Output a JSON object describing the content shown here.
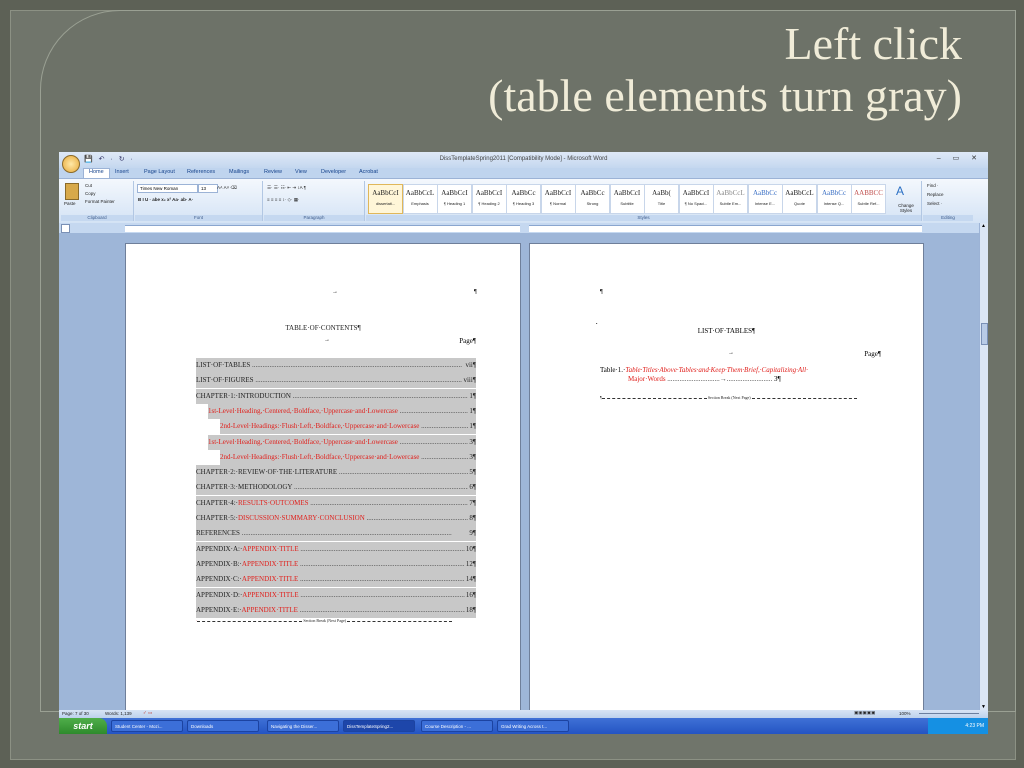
{
  "slide": {
    "title_line1": "Left click",
    "title_line2": "(table elements turn gray)"
  },
  "window": {
    "title": "DissTemplateSpring2011 [Compatibility Mode] - Microsoft Word",
    "qat": "💾 ↶ · ↻ ·",
    "controls": "– ▭ ✕"
  },
  "tabs": [
    "Home",
    "Insert",
    "Page Layout",
    "References",
    "Mailings",
    "Review",
    "View",
    "Developer",
    "Acrobat"
  ],
  "ribbon": {
    "clipboard": {
      "label": "Clipboard",
      "paste": "Paste",
      "cut": "Cut",
      "copy": "Copy",
      "format_painter": "Format Painter"
    },
    "font": {
      "label": "Font",
      "name": "Times New Roman",
      "size": "13",
      "row2": "B  I  U · abe  x₂  x²  Aa·  ab·  A·"
    },
    "paragraph": {
      "label": "Paragraph",
      "row1": "☰· ☰· ☷·  ⇤ ⇥  ↕A  ¶",
      "row2": "≡ ≡ ≡ ≡  ↕·  ◇· ▦·"
    },
    "styles": {
      "label": "Styles",
      "items": [
        {
          "preview": "AaBbCcI",
          "name": "dissertati...",
          "color": "#222"
        },
        {
          "preview": "AaBbCcL",
          "name": "Emphasis",
          "color": "#222"
        },
        {
          "preview": "AaBbCcI",
          "name": "¶ Heading 1",
          "color": "#222"
        },
        {
          "preview": "AaBbCcI",
          "name": "¶ Heading 2",
          "color": "#222"
        },
        {
          "preview": "AaBbCc",
          "name": "¶ Heading 3",
          "color": "#222"
        },
        {
          "preview": "AaBbCcI",
          "name": "¶ Normal",
          "color": "#222"
        },
        {
          "preview": "AaBbCc",
          "name": "Strong",
          "color": "#222"
        },
        {
          "preview": "AaBbCcI",
          "name": "Subtitle",
          "color": "#222"
        },
        {
          "preview": "AaBb(",
          "name": "Title",
          "color": "#222"
        },
        {
          "preview": "AaBbCcI",
          "name": "¶ No Spaci...",
          "color": "#222"
        },
        {
          "preview": "AaBbCcL",
          "name": "Subtle Em...",
          "color": "#8a8a8a"
        },
        {
          "preview": "AaBbCc",
          "name": "Intense E...",
          "color": "#3a6fc4"
        },
        {
          "preview": "AaBbCcL",
          "name": "Quote",
          "color": "#222"
        },
        {
          "preview": "AaBbCc",
          "name": "Intense Q...",
          "color": "#3a6fc4"
        },
        {
          "preview": "AABBCC",
          "name": "Subtle Ref...",
          "color": "#c0504d"
        }
      ],
      "change": "Change Styles"
    },
    "editing": {
      "label": "Editing",
      "find": "Find ·",
      "replace": "Replace",
      "select": "Select ·"
    }
  },
  "page_left": {
    "marker_arrow": "→",
    "marker_pilcrow": "¶",
    "title": "TABLE·OF·CONTENTS¶",
    "page_header_arrow": "→",
    "page_header": "Page¶",
    "rows": [
      {
        "label": "LIST·OF·TABLES",
        "red": "",
        "page": "vii¶",
        "indent": 0
      },
      {
        "label": "LIST·OF·FIGURES",
        "red": "",
        "page": "viii¶",
        "indent": 0
      },
      {
        "label": "CHAPTER·1:·INTRODUCTION",
        "red": "",
        "page": "1¶",
        "indent": 0
      },
      {
        "label": "",
        "red": "1st-Level·Heading,·Centered,·Boldface,·Uppercase·and·Lowercase",
        "page": "1¶",
        "indent": 12
      },
      {
        "label": "",
        "red": "2nd-Level·Headings:·Flush·Left,·Boldface,·Uppercase·and·Lowercase",
        "page": "1¶",
        "indent": 24
      },
      {
        "label": "",
        "red": "1st-Level·Heading,·Centered,·Boldface,·Uppercase·and·Lowercase",
        "page": "3¶",
        "indent": 12
      },
      {
        "label": "",
        "red": "2nd-Level·Headings:·Flush·Left,·Boldface,·Uppercase·and·Lowercase",
        "page": "3¶",
        "indent": 24
      },
      {
        "label": "CHAPTER·2:·REVIEW·OF·THE·LITERATURE",
        "red": "",
        "page": "5¶",
        "indent": 0
      },
      {
        "label": "CHAPTER·3:·METHODOLOGY",
        "red": "",
        "page": "6¶",
        "indent": 0
      },
      {
        "label": "CHAPTER·4:·",
        "red": "RESULTS·OUTCOMES",
        "page": "7¶",
        "indent": 0
      },
      {
        "label": "CHAPTER·5:·",
        "red": "DISCUSSION·SUMMARY·CONCLUSION",
        "page": "8¶",
        "indent": 0
      },
      {
        "label": "REFERENCES",
        "red": "",
        "page": "9¶",
        "indent": 0
      },
      {
        "label": "APPENDIX·A:·",
        "red": "APPENDIX·TITLE",
        "page": "10¶",
        "indent": 0
      },
      {
        "label": "APPENDIX·B:·",
        "red": "APPENDIX·TITLE",
        "page": "12¶",
        "indent": 0
      },
      {
        "label": "APPENDIX·C:·",
        "red": "APPENDIX·TITLE",
        "page": "14¶",
        "indent": 0
      },
      {
        "label": "APPENDIX·D:·",
        "red": "APPENDIX·TITLE",
        "page": "16¶",
        "indent": 0
      },
      {
        "label": "APPENDIX·E:·",
        "red": "APPENDIX·TITLE",
        "page": "18¶",
        "indent": 0
      }
    ],
    "section_break": "Section Break (Next Page)"
  },
  "page_right": {
    "pilcrow": "¶",
    "title": "LIST·OF·TABLES¶",
    "header_arrow": "→",
    "page_header": "Page¶",
    "entry_label": "Table·1.·",
    "entry_red_line1": "Table·Titles·Above·Tables·and·Keep·Them·Brief,·Capitalizing·All·",
    "entry_red_line2": "Major·Words",
    "entry_page": "3¶",
    "section_break": "Section Break (Next Page)"
  },
  "status": {
    "page": "Page: 7 of 30",
    "words": "Words: 1,139",
    "zoom": "100%"
  },
  "taskbar": {
    "start": "start",
    "tasks": [
      "Student Center - Mozi...",
      "Downloads",
      "Navigating the Disser...",
      "DissTemplateSpring2...",
      "Course Description - ...",
      "Grad Writing Across t..."
    ],
    "time": "4:23 PM"
  }
}
